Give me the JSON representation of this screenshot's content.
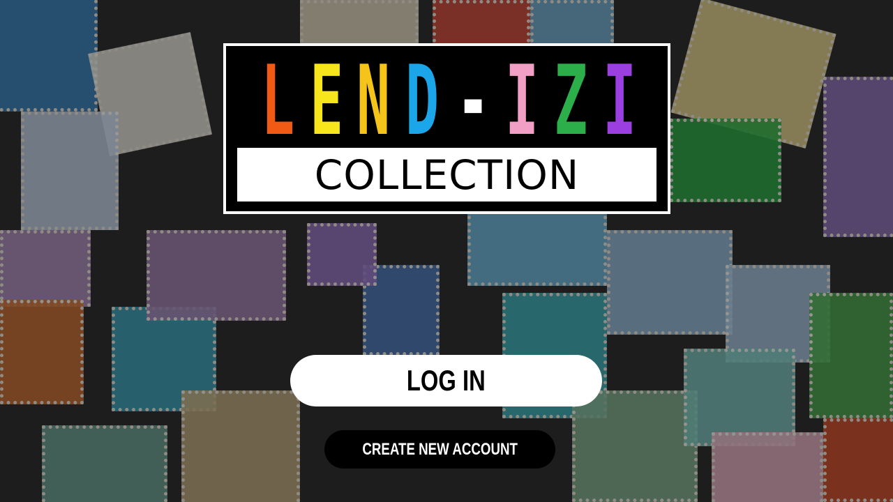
{
  "logo": {
    "title_letters": [
      {
        "char": "L",
        "color": "#f05a14"
      },
      {
        "char": "E",
        "color": "#f7e61b"
      },
      {
        "char": "N",
        "color": "#f4c41a"
      },
      {
        "char": "D",
        "color": "#1aa6e8"
      },
      {
        "char": "-",
        "color": "#ffffff"
      },
      {
        "char": "I",
        "color": "#f29fc5"
      },
      {
        "char": "Z",
        "color": "#2cae4a"
      },
      {
        "char": "I",
        "color": "#9b3fe0"
      }
    ],
    "subtitle": "COLLECTION"
  },
  "actions": {
    "login_label": "LOG IN",
    "create_account_label": "CREATE NEW ACCOUNT"
  },
  "background": {
    "description_icon": "stamp-collage-background"
  }
}
